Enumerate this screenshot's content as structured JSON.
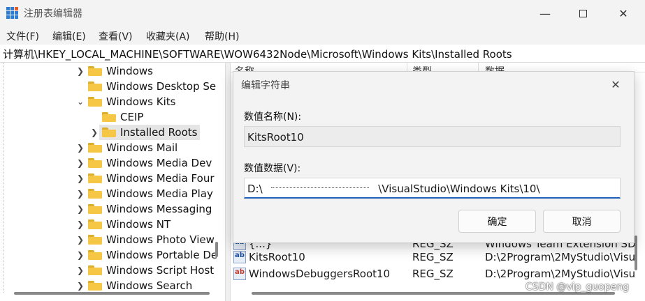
{
  "window": {
    "title": "注册表编辑器",
    "controls": {
      "minimize_icon": "minimize-icon",
      "maximize_icon": "maximize-icon",
      "close_icon": "close-icon"
    }
  },
  "menu": {
    "items": [
      "文件(F)",
      "编辑(E)",
      "查看(V)",
      "收藏夹(A)",
      "帮助(H)"
    ]
  },
  "address": {
    "path": "计算机\\HKEY_LOCAL_MACHINE\\SOFTWARE\\WOW6432Node\\Microsoft\\Windows Kits\\Installed Roots"
  },
  "tree": {
    "nodes": [
      {
        "label": "Windows",
        "expanded": false,
        "selected": false
      },
      {
        "label": "Windows Desktop Se",
        "expanded": null,
        "selected": false
      },
      {
        "label": "Windows Kits",
        "expanded": true,
        "selected": false
      },
      {
        "label": "CEIP",
        "expanded": null,
        "selected": false
      },
      {
        "label": "Installed Roots",
        "expanded": false,
        "selected": true
      },
      {
        "label": "Windows Mail",
        "expanded": false,
        "selected": false
      },
      {
        "label": "Windows Media Dev",
        "expanded": false,
        "selected": false
      },
      {
        "label": "Windows Media Four",
        "expanded": false,
        "selected": false
      },
      {
        "label": "Windows Media Play",
        "expanded": false,
        "selected": false
      },
      {
        "label": "Windows Messaging",
        "expanded": false,
        "selected": false
      },
      {
        "label": "Windows NT",
        "expanded": false,
        "selected": false
      },
      {
        "label": "Windows Photo View",
        "expanded": false,
        "selected": false
      },
      {
        "label": "Windows Portable De",
        "expanded": false,
        "selected": false
      },
      {
        "label": "Windows Script Host",
        "expanded": false,
        "selected": false
      },
      {
        "label": "Windows Search",
        "expanded": false,
        "selected": false
      }
    ]
  },
  "list": {
    "headers": [
      "名称",
      "类型",
      "数据"
    ],
    "rows": [
      {
        "name": "{...}",
        "type": "REG_SZ",
        "data": "Windows Team Extension SD"
      },
      {
        "name": "KitsRoot10",
        "type": "REG_SZ",
        "data": "D:\\2Program\\2MyStudio\\Visu"
      },
      {
        "name": "WindowsDebuggersRoot10",
        "type": "REG_SZ",
        "data": "D:\\2Program\\2MyStudio\\Visu"
      }
    ]
  },
  "dialog": {
    "title": "编辑字符串",
    "value_name_label": "数值名称(N):",
    "value_name": "KitsRoot10",
    "value_data_label": "数值数据(V):",
    "value_data_prefix": "D:\\",
    "value_data_suffix": "\\VisualStudio\\Windows Kits\\10\\",
    "ok_label": "确定",
    "cancel_label": "取消"
  },
  "watermark": "CSDN @vip_guopeng"
}
